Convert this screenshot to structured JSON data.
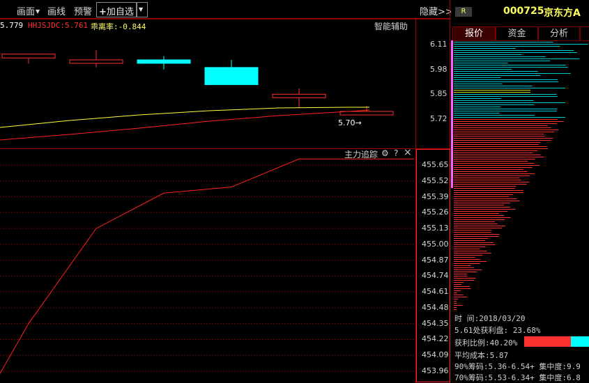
{
  "toolbar": {
    "draw_label": "画面",
    "line_label": "画线",
    "alert_label": "预警",
    "add_label": "加自选",
    "hide_label": "隐藏>>"
  },
  "indicators": {
    "ma_value": "5.779",
    "hhjs_label": "HHJSJDC:5.761",
    "deviation_label": "乖离率:-0.844",
    "assist_label": "智能辅助"
  },
  "main_panel": {
    "price_axis": [
      "6.11",
      "5.98",
      "5.85",
      "5.72"
    ],
    "marker_label": "5.70→",
    "candles": [
      {
        "open": 6.04,
        "close": 6.06,
        "high": 6.06,
        "low": 6.01
      },
      {
        "open": 6.02,
        "close": 6.03,
        "high": 6.08,
        "low": 5.99
      },
      {
        "open": 6.03,
        "close": 6.02,
        "high": 6.05,
        "low": 5.98
      },
      {
        "open": 5.99,
        "close": 5.9,
        "high": 6.03,
        "low": 5.9
      },
      {
        "open": 5.84,
        "close": 5.85,
        "high": 5.88,
        "low": 5.78
      },
      {
        "open": 5.75,
        "close": 5.76,
        "high": 5.79,
        "low": 5.75
      }
    ],
    "colors": {
      "up": "#ff3030",
      "down": "#00ffff",
      "ma": "#ffff40",
      "ma2": "#ff2020"
    }
  },
  "sub_panel": {
    "title": "主力追踪",
    "settings_icon": "gear-icon",
    "help_label": "?",
    "close_label": "×",
    "axis": [
      "455.65",
      "455.52",
      "455.39",
      "455.26",
      "455.13",
      "455.00",
      "454.87",
      "454.74",
      "454.61",
      "454.48",
      "454.35",
      "454.22",
      "454.09",
      "453.96"
    ],
    "series": [
      453.94,
      454.35,
      455.13,
      455.42,
      455.47,
      455.7,
      455.7
    ]
  },
  "right_panel": {
    "badge": "R",
    "stock_code": "000725",
    "stock_name": "京东方A",
    "tabs": [
      "报价",
      "资金",
      "分析"
    ],
    "date_label": "时      间:2018/03/20",
    "profit_label": "5.61处获利盘: 23.68%",
    "ratio_label": "获利比例:40.20%",
    "ratio_value": 0.402,
    "avg_cost": "平均成本:5.87",
    "chip90": "90%筹码:5.36-6.54+ 集中度:9.9",
    "chip70": "70%筹码:5.53-6.34+ 集中度:6.8"
  }
}
